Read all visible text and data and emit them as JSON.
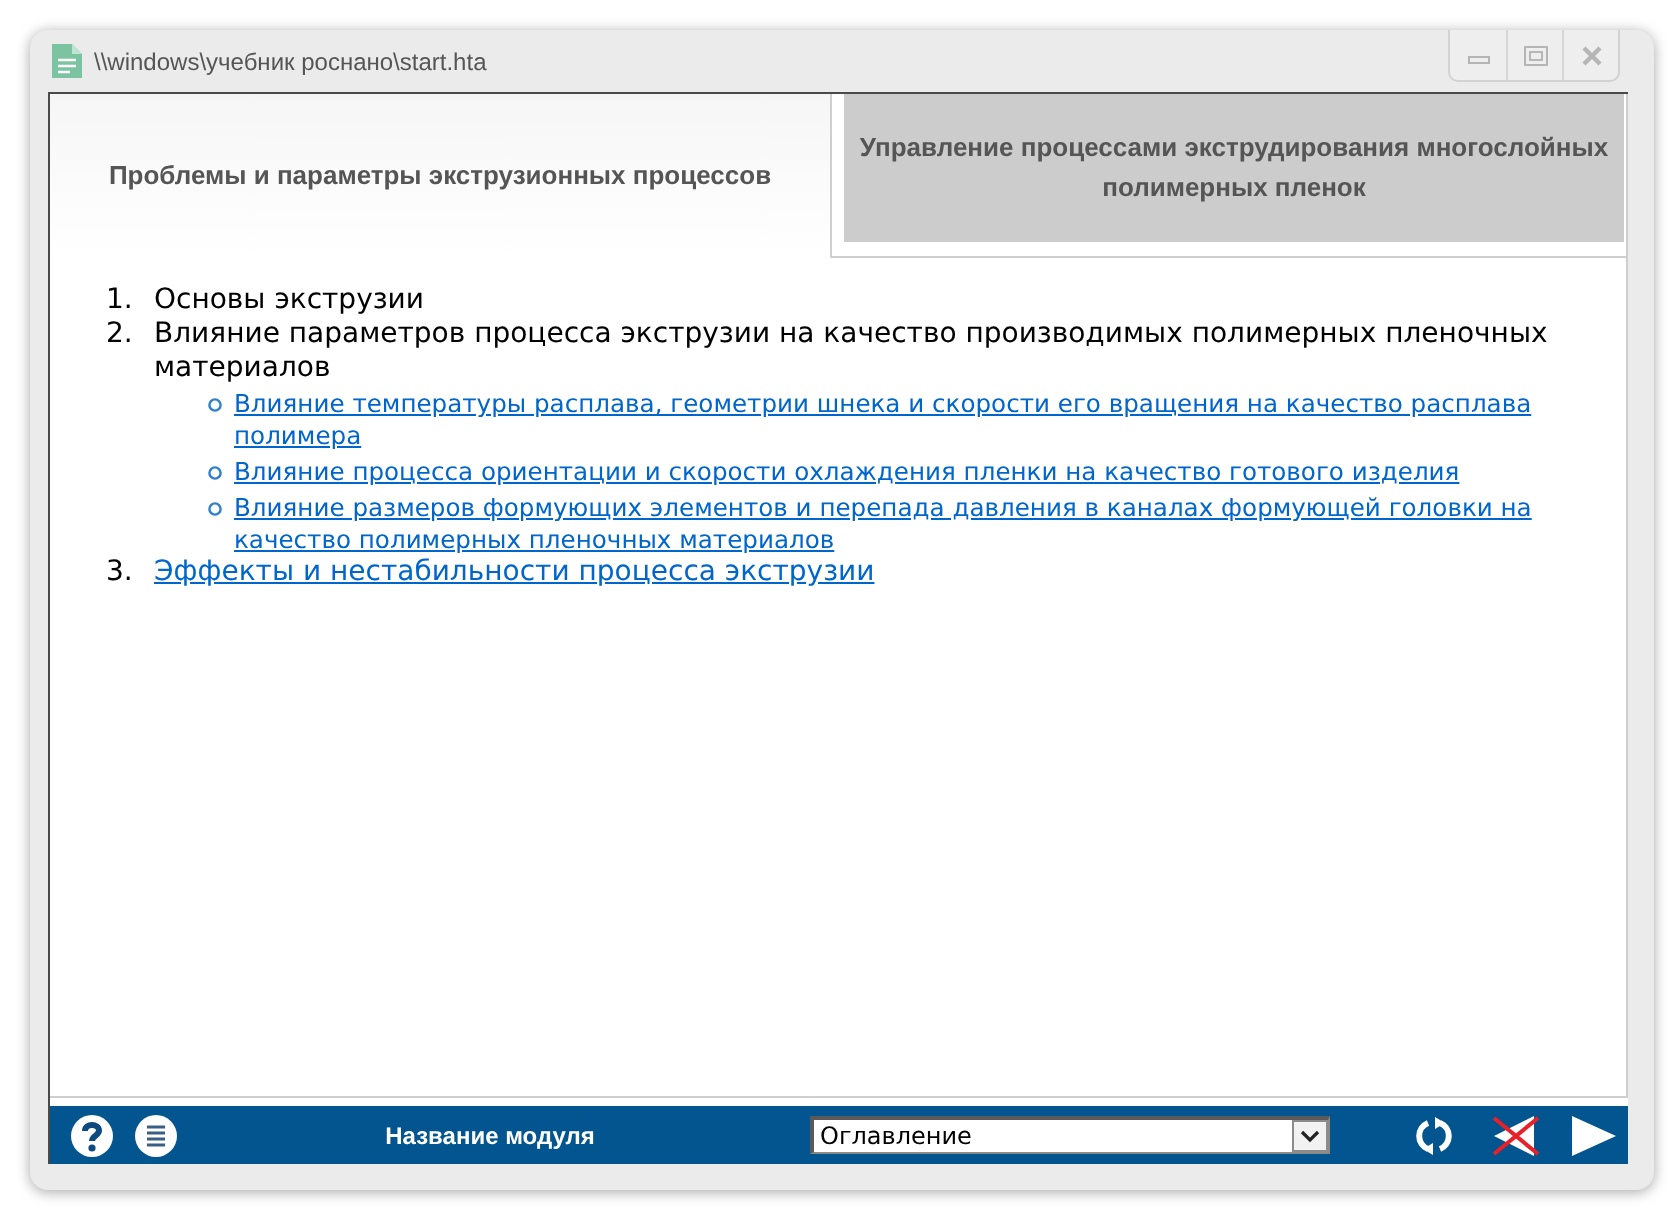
{
  "window": {
    "title": "\\\\windows\\учебник роснано\\start.hta"
  },
  "header_tabs": [
    {
      "label": "Проблемы и параметры экструзионных процессов",
      "selected": true
    },
    {
      "label": "Управление процессами экструдирования многослойных полимерных пленок",
      "selected": false
    }
  ],
  "contents": [
    {
      "number": "1.",
      "label": "Основы экструзии",
      "kind": "text"
    },
    {
      "number": "2.",
      "label": "Влияние параметров процесса экструзии на качество производимых полимерных пленочных материалов",
      "kind": "text",
      "children": [
        {
          "label": "Влияние температуры расплава, геометрии шнека и скорости его вращения на качество расплава полимера",
          "kind": "link"
        },
        {
          "label": "Влияние процесса ориентации и скорости охлаждения пленки на качество готового изделия",
          "kind": "link"
        },
        {
          "label": "Влияние размеров формующих элементов и перепада давления в каналах формующей головки на качество полимерных пленочных материалов",
          "kind": "link"
        }
      ]
    },
    {
      "number": "3.",
      "label": "Эффекты и нестабильности процесса экструзии",
      "kind": "link"
    }
  ],
  "bottom_bar": {
    "module_label": "Название модуля",
    "dropdown": {
      "value": "Оглавление"
    },
    "back_button": {
      "disabled": true
    }
  }
}
